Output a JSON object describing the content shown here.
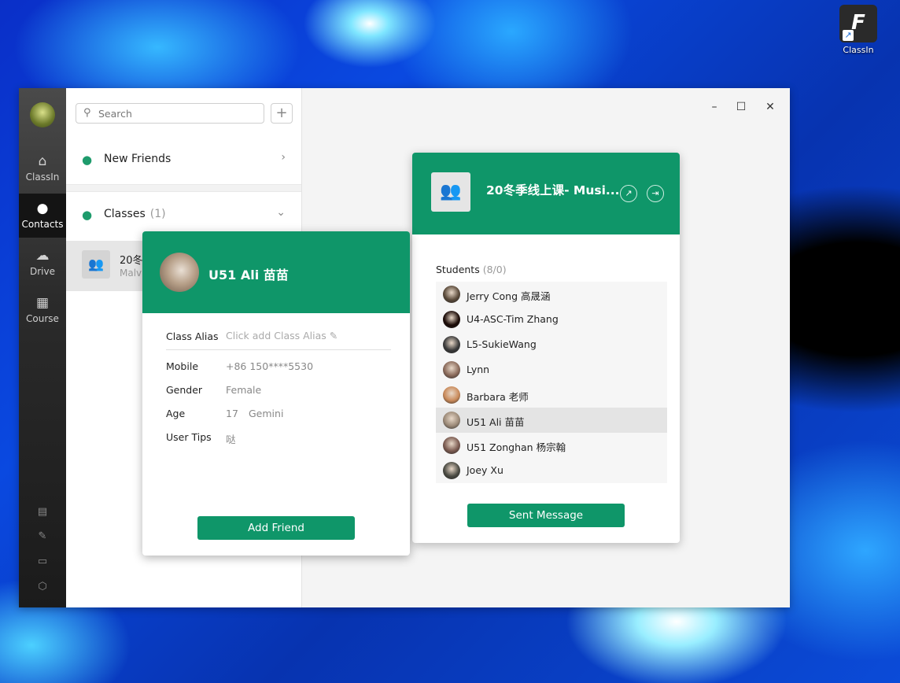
{
  "desktop": {
    "shortcut_label": "ClassIn",
    "shortcut_glyph": "F"
  },
  "sidebar": {
    "items": [
      {
        "label": "ClassIn",
        "icon": "home-icon"
      },
      {
        "label": "Contacts",
        "icon": "person-icon"
      },
      {
        "label": "Drive",
        "icon": "cloud-icon"
      },
      {
        "label": "Course",
        "icon": "calendar-icon"
      }
    ]
  },
  "contacts": {
    "search_placeholder": "Search",
    "add_label": "+",
    "new_friends_label": "New Friends",
    "classes_label": "Classes",
    "classes_count": "(1)",
    "class_item": {
      "title": "20冬",
      "subtitle": "Malv"
    }
  },
  "window_controls": {
    "minimize": "–",
    "maximize": "☐",
    "close": "✕"
  },
  "group_card": {
    "name": "20冬季线上课- Musi...",
    "students_label": "Students",
    "students_count": "(8/0)",
    "students": [
      {
        "name": "Jerry Cong 高晟涵",
        "color": "#5a4a3a"
      },
      {
        "name": "U4-ASC-Tim Zhang",
        "color": "#1a0a06"
      },
      {
        "name": "L5-SukieWang",
        "color": "#3a3a3a"
      },
      {
        "name": "Lynn",
        "color": "#8a6a5a"
      },
      {
        "name": "Barbara 老师",
        "color": "#c98a5a"
      },
      {
        "name": "U51 Ali 苗苗",
        "color": "#9c8a78"
      },
      {
        "name": "U51 Zonghan 杨宗翰",
        "color": "#7a5a50"
      },
      {
        "name": "Joey Xu",
        "color": "#4a4a42"
      }
    ],
    "selected_index": 5,
    "send_button": "Sent Message"
  },
  "user_card": {
    "name": "U51 Ali 苗苗",
    "class_alias_label": "Class Alias",
    "class_alias_placeholder": "Click add Class Alias",
    "mobile_label": "Mobile",
    "mobile_value": "+86 150****5530",
    "gender_label": "Gender",
    "gender_value": "Female",
    "age_label": "Age",
    "age_value": "17",
    "zodiac_value": "Gemini",
    "tips_label": "User Tips",
    "tips_value": "哒",
    "add_button": "Add Friend"
  },
  "colors": {
    "brand": "#0f9669",
    "sidebar": "#2b2b2b"
  }
}
